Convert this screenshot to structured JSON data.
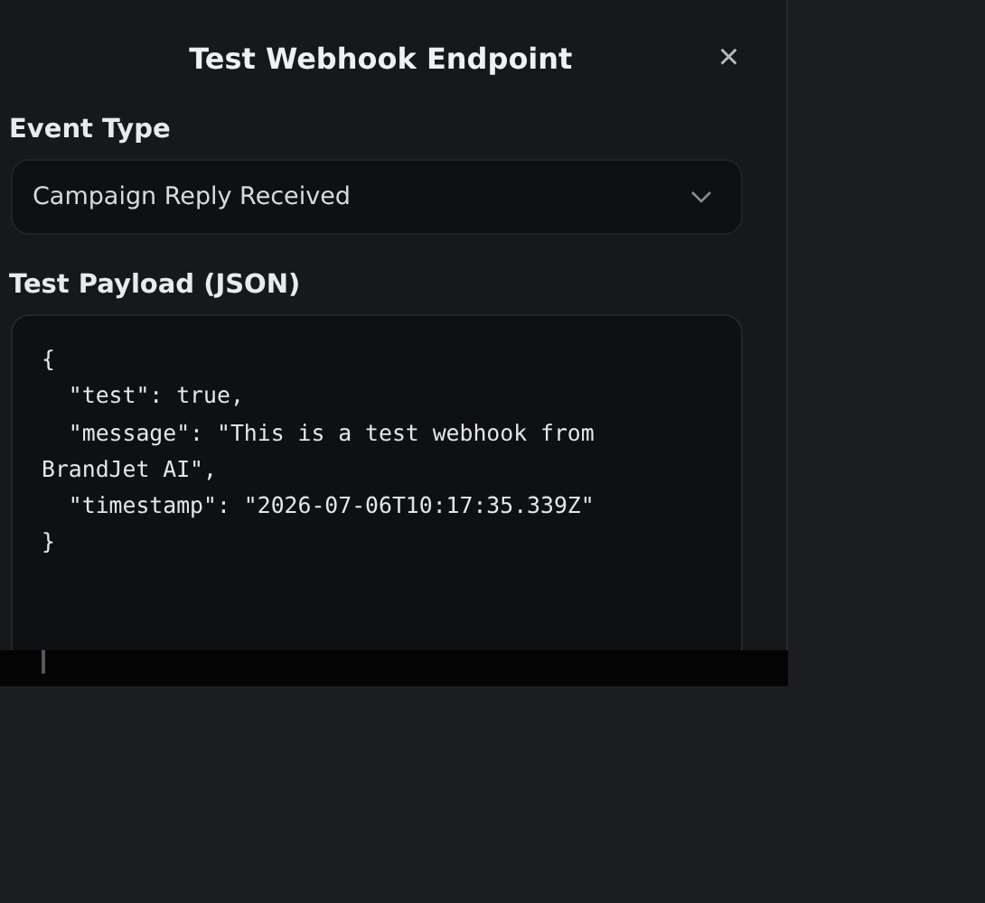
{
  "dialog": {
    "title": "Test Webhook Endpoint",
    "close": "×"
  },
  "event_type": {
    "label": "Event Type",
    "value": "Campaign Reply Received"
  },
  "payload": {
    "label": "Test Payload (JSON)",
    "value": "{\n  \"test\": true,\n  \"message\": \"This is a test webhook from BrandJet AI\",\n  \"timestamp\": \"2026-07-06T10:17:35.339Z\"\n}"
  }
}
